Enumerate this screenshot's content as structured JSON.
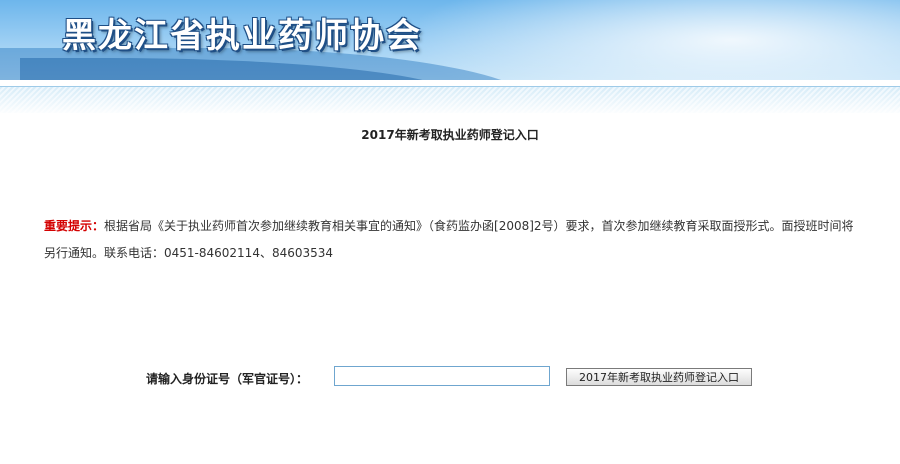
{
  "header": {
    "title": "黑龙江省执业药师协会"
  },
  "main": {
    "page_title": "2017年新考取执业药师登记入口",
    "notice": {
      "label": "重要提示：",
      "text": "根据省局《关于执业药师首次参加继续教育相关事宜的通知》（食药监办函[2008]2号）要求，首次参加继续教育采取面授形式。面授班时间将另行通知。联系电话：0451-84602114、84603534"
    },
    "form": {
      "id_label": "请输入身份证号（军官证号）：",
      "id_value": "",
      "id_placeholder": "",
      "submit_label": "2017年新考取执业药师登记入口"
    }
  },
  "colors": {
    "banner_blue": "#6db6ec",
    "title_outline": "#1f4f86",
    "notice_red": "#d40000"
  }
}
